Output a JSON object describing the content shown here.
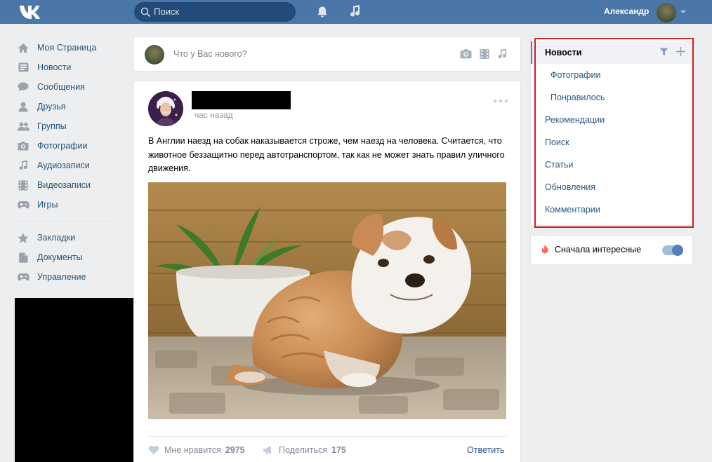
{
  "header": {
    "search_placeholder": "Поиск",
    "user_name": "Александр",
    "bg_color": "#4a76a8"
  },
  "nav": {
    "items": [
      {
        "label": "Моя Страница",
        "icon": "home-icon"
      },
      {
        "label": "Новости",
        "icon": "news-icon"
      },
      {
        "label": "Сообщения",
        "icon": "messages-icon"
      },
      {
        "label": "Друзья",
        "icon": "friends-icon"
      },
      {
        "label": "Группы",
        "icon": "groups-icon"
      },
      {
        "label": "Фотографии",
        "icon": "camera-icon"
      },
      {
        "label": "Аудиозаписи",
        "icon": "music-icon"
      },
      {
        "label": "Видеозаписи",
        "icon": "video-icon"
      },
      {
        "label": "Игры",
        "icon": "gamepad-icon"
      }
    ],
    "secondary": [
      {
        "label": "Закладки",
        "icon": "star-icon"
      },
      {
        "label": "Документы",
        "icon": "document-icon"
      },
      {
        "label": "Управление",
        "icon": "gamepad-icon"
      }
    ]
  },
  "composer": {
    "placeholder": "Что у Вас нового?"
  },
  "post": {
    "time": "час назад",
    "text": "В Англии наезд на собак наказывается строже, чем наезд на человека. Считается, что животное беззащитно перед автотранспортом, так как не может знать правил уличного движения.",
    "like_label": "Мне нравится",
    "like_count": "2975",
    "share_label": "Поделиться",
    "share_count": "175",
    "reply_label": "Ответить"
  },
  "right_menu": {
    "items": [
      {
        "label": "Новости",
        "active": true
      },
      {
        "label": "Фотографии",
        "sub": true
      },
      {
        "label": "Понравилось",
        "sub": true
      },
      {
        "label": "Рекомендации"
      },
      {
        "label": "Поиск"
      },
      {
        "label": "Статьи"
      },
      {
        "label": "Обновления"
      },
      {
        "label": "Комментарии"
      }
    ],
    "highlight_color": "#d21e1e"
  },
  "interesting": {
    "label": "Сначала интересные",
    "enabled": true
  }
}
